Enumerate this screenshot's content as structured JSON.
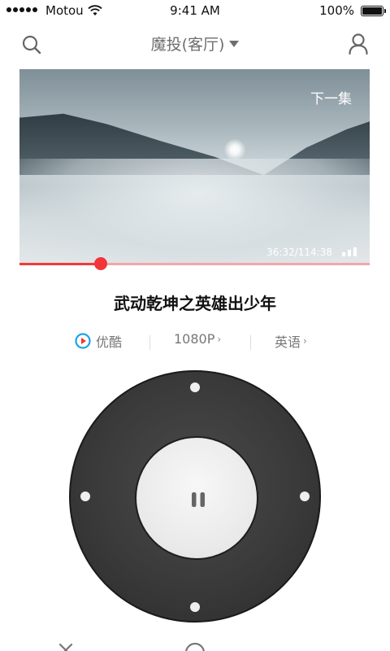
{
  "status_bar": {
    "carrier": "Motou",
    "time": "9:41 AM",
    "battery_pct": "100%"
  },
  "nav": {
    "title": "魔投(客厅)",
    "search_icon": "search-icon",
    "user_icon": "user-icon"
  },
  "video": {
    "next_episode": "下一集",
    "timecode": "36:32/114:38",
    "progress": 0.232
  },
  "show": {
    "title": "武动乾坤之英雄出少年"
  },
  "options": {
    "source": "优酷",
    "resolution": "1080P",
    "language": "英语"
  },
  "remote": {
    "center_icon": "pause-icon"
  },
  "colors": {
    "accent": "#f2353a",
    "dpad": "#3a3a3a",
    "youku_blue": "#1aa3e8"
  }
}
